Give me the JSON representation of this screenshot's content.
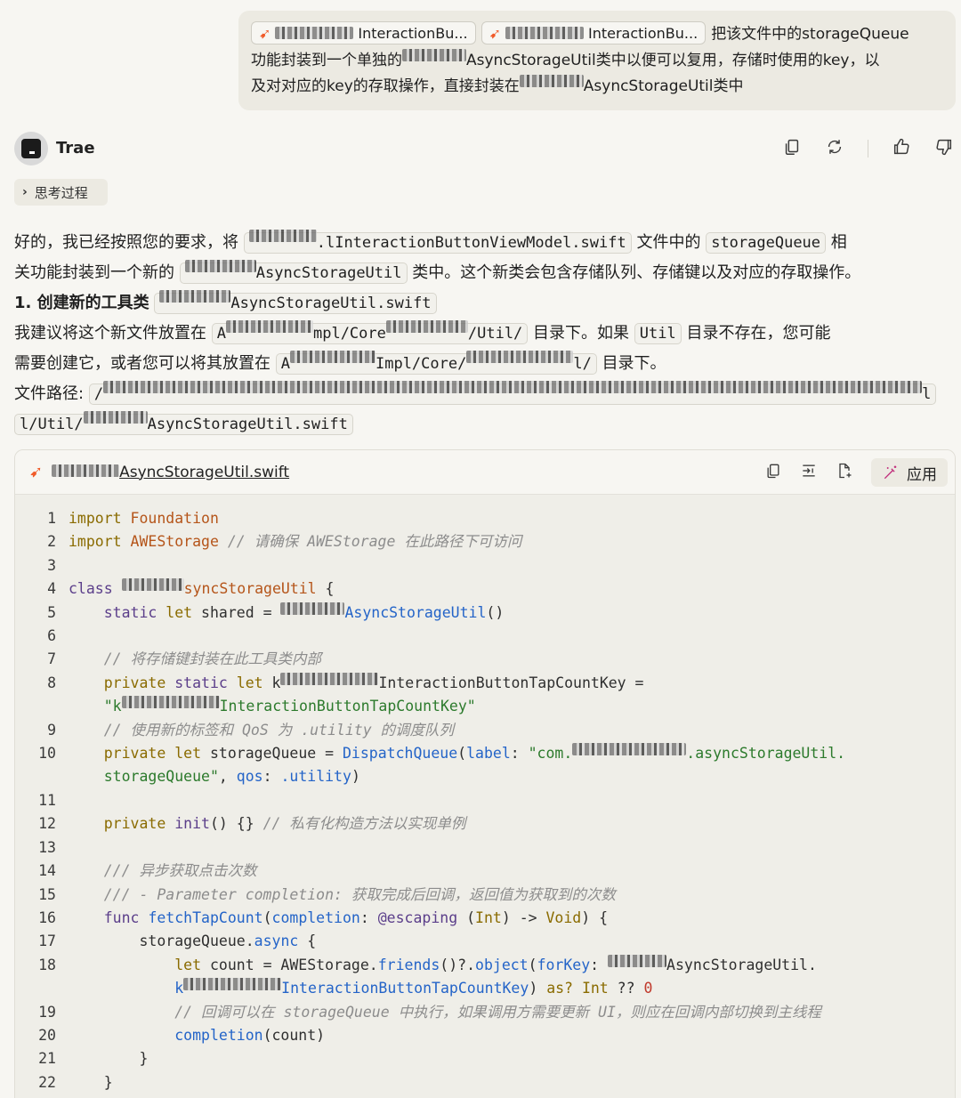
{
  "user_message": {
    "chip1_label": "InteractionBu...",
    "chip2_label": "InteractionBu...",
    "text_line1": "把该文件中的storageQueue",
    "text_line2a": "功能封装到一个单独的",
    "text_line2b": "AsyncStorageUtil类中以便可以复用，存储时使用的key，以",
    "text_line3a": "及对对应的key的存取操作，直接封装在",
    "text_line3b": "AsyncStorageUtil类中"
  },
  "assistant": {
    "name": "Trae",
    "thinking_label": "思考过程",
    "p1_a": "好的，我已经按照您的要求，将",
    "p1_code1": ".lInteractionButtonViewModel.swift",
    "p1_b": "文件中的",
    "p1_code2": "storageQueue",
    "p1_c": "相",
    "p2_a": "关功能封装到一个新的",
    "p2_code": "AsyncStorageUtil",
    "p2_b": "类中。这个新类会包含存储队列、存储键以及对应的存取操作。",
    "p3_bold": "1. 创建新的工具类",
    "p3_code": "AsyncStorageUtil.swift",
    "p4_a": "我建议将这个新文件放置在",
    "p4_code1a": "A",
    "p4_code1b": "mpl/Core",
    "p4_code1c": "/Util/",
    "p4_b": "目录下。如果",
    "p4_code2": "Util",
    "p4_c": "目录不存在，您可能",
    "p5_a": "需要创建它，或者您可以将其放置在",
    "p5_code1a": "A",
    "p5_code1b": "Impl/Core/",
    "p5_code1c": "l/",
    "p5_b": "目录下。",
    "p6_a": "文件路径:",
    "p6_code_start": "/",
    "p6_code_end": "l",
    "p7_code_a": "l/Util/",
    "p7_code_b": "AsyncStorageUtil.swift"
  },
  "code_card": {
    "filename": "AsyncStorageUtil.swift",
    "apply_label": "应用"
  },
  "code": {
    "l1_kw": "import",
    "l1_mod": "Foundation",
    "l2_kw": "import",
    "l2_mod": "AWEStorage",
    "l2_cm": "// 请确保 AWEStorage 在此路径下可访问",
    "l4_kw": "class",
    "l4_name": "syncStorageUtil",
    "l4_brace": " {",
    "l5_kw1": "static",
    "l5_kw2": "let",
    "l5_name": " shared = ",
    "l5_type": "AsyncStorageUtil",
    "l5_paren": "()",
    "l7_cm": "// 将存储键封装在此工具类内部",
    "l8_kw1": "private",
    "l8_kw2": "static",
    "l8_kw3": "let",
    "l8_name_a": "k",
    "l8_name_b": "InteractionButtonTapCountKey",
    "l8_eq": " =",
    "l8b_str_a": "\"k",
    "l8b_str_b": "InteractionButtonTapCountKey\"",
    "l9_cm": "// 使用新的标签和 QoS 为 .utility 的调度队列",
    "l10_kw1": "private",
    "l10_kw2": "let",
    "l10_name": " storageQueue = ",
    "l10_type": "DispatchQueue",
    "l10_label": "label",
    "l10_str_a": "\"com.",
    "l10_str_b": ".asyncStorageUtil.",
    "l10b_str": "storageQueue\"",
    "l10b_qos": "qos",
    "l10b_val": ".utility",
    "l12_kw": "private",
    "l12_fn": "init",
    "l12_rest": "() {}",
    "l12_cm": "// 私有化构造方法以实现单例",
    "l14_cm": "/// 异步获取点击次数",
    "l15_cm": "/// - Parameter completion: 获取完成后回调，返回值为获取到的次数",
    "l16_kw": "func",
    "l16_fn": "fetchTapCount",
    "l16_param": "completion",
    "l16_attr": "@escaping",
    "l16_type": "Int",
    "l16_void": "Void",
    "l17_obj": "storageQueue",
    "l17_fn": "async",
    "l18_kw": "let",
    "l18_a": " count = AWEStorage.",
    "l18_fn1": "friends",
    "l18_b": "()?.",
    "l18_fn2": "object",
    "l18_c": "(",
    "l18_param": "forKey",
    "l18_d": ": ",
    "l18_e": "AsyncStorageUtil.",
    "l18b_a": "k",
    "l18b_b": "InteractionButtonTapCountKey",
    "l18b_c": ") ",
    "l18b_as": "as?",
    "l18b_type": "Int",
    "l18b_op": " ?? ",
    "l18b_num": "0",
    "l19_cm": "// 回调可以在 storageQueue 中执行，如果调用方需要更新 UI，则应在回调内部切换到主线程",
    "l20_fn": "completion",
    "l20_arg": "(count)",
    "l21": "}",
    "l22": "}"
  },
  "colors": {
    "background": "#f7f6f2",
    "bubble": "#eceae2",
    "code_bg": "#efeee8",
    "swift_orange": "#f05a28",
    "apply_magenta": "#c02c7a"
  }
}
